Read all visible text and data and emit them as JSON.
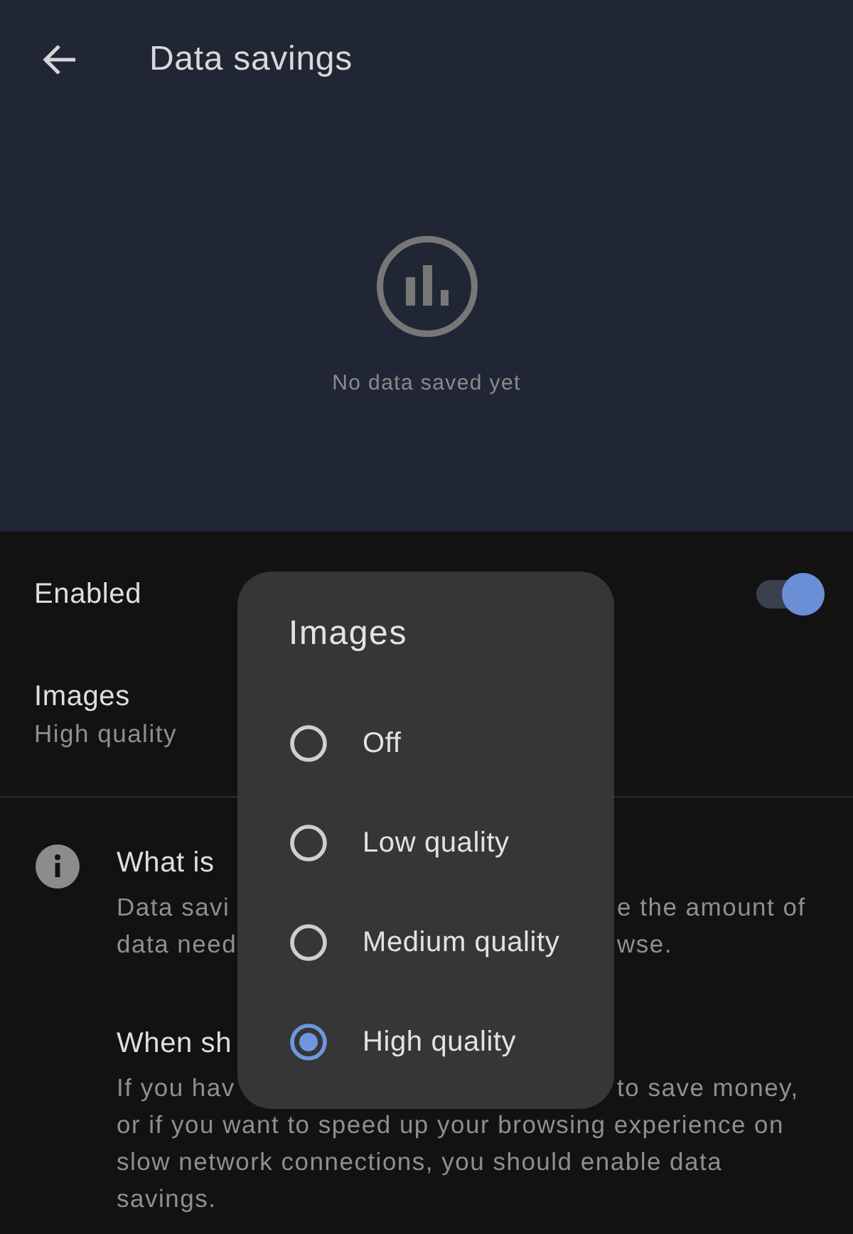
{
  "app_bar": {
    "title": "Data savings"
  },
  "summary": {
    "message": "No data saved yet"
  },
  "settings": [
    {
      "kind": "switch",
      "label": "Enabled",
      "on": true
    },
    {
      "kind": "value",
      "label": "Images",
      "value": "High quality"
    }
  ],
  "about": {
    "sections": [
      {
        "title": "What is",
        "lines": [
          {
            "left": "Data savi",
            "right": "e the amount of"
          },
          {
            "left": "data need",
            "right": "wse."
          }
        ]
      },
      {
        "title": "When sh",
        "lines": [
          {
            "left": "If you hav",
            "right": "to save money,"
          }
        ],
        "text": "or if you want to speed up your browsing experience on slow network connections, you should enable data savings."
      }
    ]
  },
  "dialog": {
    "title": "Images",
    "options": [
      {
        "label": "Off",
        "selected": false
      },
      {
        "label": "Low quality",
        "selected": false
      },
      {
        "label": "Medium quality",
        "selected": false
      },
      {
        "label": "High quality",
        "selected": true
      }
    ]
  }
}
